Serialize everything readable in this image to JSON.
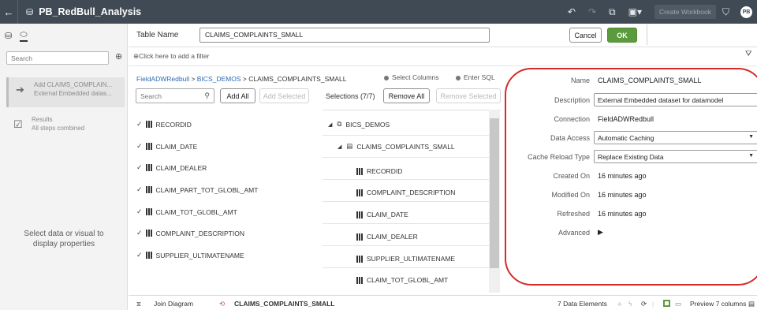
{
  "topbar": {
    "back_icon": "back-arrow-icon",
    "title": "PB_RedBull_Analysis",
    "create_workbook": "Create Workbook",
    "avatar": "PB"
  },
  "left": {
    "search_placeholder": "Search",
    "steps": [
      {
        "title": "Add CLAIMS_COMPLAIN...",
        "subtitle": "External Embedded datas..."
      },
      {
        "title": "Results",
        "subtitle": "All steps combined"
      }
    ],
    "hint_line1": "Select data or visual to",
    "hint_line2": "display properties"
  },
  "header": {
    "table_name_label": "Table Name",
    "table_name_value": "CLAIMS_COMPLAINTS_SMALL",
    "cancel": "Cancel",
    "ok": "OK"
  },
  "filter": {
    "text": "Click here to add a filter"
  },
  "breadcrumb": {
    "part1": "FieldADWRedbull",
    "sep1": " > ",
    "part2": "BICS_DEMOS",
    "sep2": " > ",
    "part3": "CLAIMS_COMPLAINTS_SMALL"
  },
  "modes": {
    "select_columns": "Select Columns",
    "enter_sql": "Enter SQL"
  },
  "available": {
    "search_placeholder": "Search",
    "add_all": "Add All",
    "add_selected": "Add Selected",
    "columns": [
      "RECORDID",
      "CLAIM_DATE",
      "CLAIM_DEALER",
      "CLAIM_PART_TOT_GLOBL_AMT",
      "CLAIM_TOT_GLOBL_AMT",
      "COMPLAINT_DESCRIPTION",
      "SUPPLIER_ULTIMATENAME"
    ]
  },
  "selections": {
    "header": "Selections (7/7)",
    "remove_all": "Remove All",
    "remove_selected": "Remove Selected",
    "schema": "BICS_DEMOS",
    "table": "CLAIMS_COMPLAINTS_SMALL",
    "columns": [
      "RECORDID",
      "COMPLAINT_DESCRIPTION",
      "CLAIM_DATE",
      "CLAIM_DEALER",
      "SUPPLIER_ULTIMATENAME",
      "CLAIM_TOT_GLOBL_AMT"
    ]
  },
  "properties": {
    "name_label": "Name",
    "name_value": "CLAIMS_COMPLAINTS_SMALL",
    "description_label": "Description",
    "description_value": "External Embedded dataset for datamodel",
    "connection_label": "Connection",
    "connection_value": "FieldADWRedbull",
    "data_access_label": "Data Access",
    "data_access_value": "Automatic Caching",
    "cache_reload_label": "Cache Reload Type",
    "cache_reload_value": "Replace Existing Data",
    "created_label": "Created On",
    "created_value": "16 minutes ago",
    "modified_label": "Modified On",
    "modified_value": "16 minutes ago",
    "refreshed_label": "Refreshed",
    "refreshed_value": "16 minutes ago",
    "advanced_label": "Advanced"
  },
  "bottom": {
    "join_diagram": "Join Diagram",
    "table": "CLAIMS_COMPLAINTS_SMALL",
    "data_elements": "7 Data Elements",
    "preview": "Preview 7 columns"
  },
  "colors": {
    "topbar": "#3f4a54",
    "ok_green": "#5b9a3d",
    "annotation_red": "#d62a2a",
    "link_blue": "#2a6bb5"
  }
}
